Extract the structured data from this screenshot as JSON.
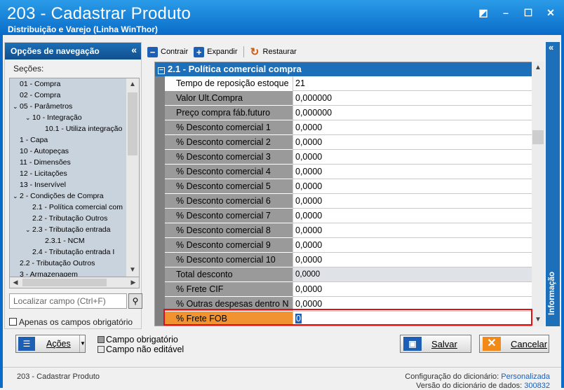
{
  "window": {
    "title": "203 - Cadastrar  Produto",
    "subtitle": "Distribuição e Varejo (Linha WinThor)",
    "controls": [
      "◩",
      "–",
      "☐",
      "✕"
    ]
  },
  "nav": {
    "header": "Opções de navegação",
    "collapse": "«",
    "sections_label": "Seções:",
    "tree": [
      {
        "label": "01 - Compra",
        "indent": 0,
        "expander": ""
      },
      {
        "label": "02 - Compra",
        "indent": 0,
        "expander": ""
      },
      {
        "label": "05 - Parâmetros",
        "indent": 0,
        "expander": "⌄"
      },
      {
        "label": "10 - Integração",
        "indent": 1,
        "expander": "⌄"
      },
      {
        "label": "10.1 - Utiliza integração",
        "indent": 2,
        "expander": ""
      },
      {
        "label": "1 - Capa",
        "indent": 0,
        "expander": ""
      },
      {
        "label": "10 - Autopeças",
        "indent": 0,
        "expander": ""
      },
      {
        "label": "11 - Dimensões",
        "indent": 0,
        "expander": ""
      },
      {
        "label": "12 - Licitações",
        "indent": 0,
        "expander": ""
      },
      {
        "label": "13 - Inservível",
        "indent": 0,
        "expander": ""
      },
      {
        "label": "2 - Condições de Compra",
        "indent": 0,
        "expander": "⌄"
      },
      {
        "label": "2.1 - Política comercial com",
        "indent": 1,
        "expander": ""
      },
      {
        "label": "2.2 - Tributação Outros",
        "indent": 1,
        "expander": ""
      },
      {
        "label": "2.3 - Tributação entrada",
        "indent": 1,
        "expander": "⌄"
      },
      {
        "label": "2.3.1 - NCM",
        "indent": 2,
        "expander": ""
      },
      {
        "label": "2.4 - Tributação entrada I",
        "indent": 1,
        "expander": ""
      },
      {
        "label": "2.2 - Tributação Outros",
        "indent": 0,
        "expander": ""
      },
      {
        "label": "3 - Armazenagem",
        "indent": 0,
        "expander": ""
      }
    ],
    "search_placeholder": "Localizar campo (Ctrl+F)",
    "only_required_label": "Apenas os campos obrigatório"
  },
  "toolbar": {
    "collapse_label": "Contrair",
    "expand_label": "Expandir",
    "restore_label": "Restaurar"
  },
  "grid": {
    "section_title": "2.1 - Política comercial compra",
    "rows": [
      {
        "label": "Tempo de reposição estoque",
        "value": "21",
        "state": "sel"
      },
      {
        "label": "Valor Ult.Compra",
        "value": "0,000000",
        "state": ""
      },
      {
        "label": "Preço compra fáb.futuro",
        "value": "0,000000",
        "state": ""
      },
      {
        "label": "% Desconto comercial 1",
        "value": "0,0000",
        "state": ""
      },
      {
        "label": "% Desconto comercial 2",
        "value": "0,0000",
        "state": ""
      },
      {
        "label": "% Desconto comercial 3",
        "value": "0,0000",
        "state": ""
      },
      {
        "label": "% Desconto comercial 4",
        "value": "0,0000",
        "state": ""
      },
      {
        "label": "% Desconto comercial 5",
        "value": "0,0000",
        "state": ""
      },
      {
        "label": "% Desconto comercial 6",
        "value": "0,0000",
        "state": ""
      },
      {
        "label": "% Desconto comercial 7",
        "value": "0,0000",
        "state": ""
      },
      {
        "label": "% Desconto comercial 8",
        "value": "0,0000",
        "state": ""
      },
      {
        "label": "% Desconto comercial 9",
        "value": "0,0000",
        "state": ""
      },
      {
        "label": "% Desconto comercial 10",
        "value": "0,0000",
        "state": ""
      },
      {
        "label": "Total desconto",
        "value": "0,0000",
        "state": "ro"
      },
      {
        "label": "% Frete CIF",
        "value": "0,0000",
        "state": ""
      },
      {
        "label": "% Outras despesas dentro N",
        "value": "0,0000",
        "state": ""
      },
      {
        "label": "% Frete FOB",
        "value": "0",
        "state": "fob"
      }
    ]
  },
  "info_tab": {
    "label": "Informação",
    "collapse": "«"
  },
  "footer": {
    "actions_label": "Ações",
    "legend_required": "Campo obrigatório",
    "legend_readonly": "Campo não editável",
    "save_label": "Salvar",
    "cancel_label": "Cancelar"
  },
  "status": {
    "left": "203 - Cadastrar  Produto",
    "dict_config_label": "Configuração do dicionário:",
    "dict_config_value": "Personalizada",
    "dict_version_label": "Versão do dicionário de dados:",
    "dict_version_value": "300832"
  },
  "colors": {
    "title_bar": "#0a6cc8",
    "section_header": "#1c6fb8",
    "required_field": "#f09330",
    "highlight_border": "#e01010"
  }
}
